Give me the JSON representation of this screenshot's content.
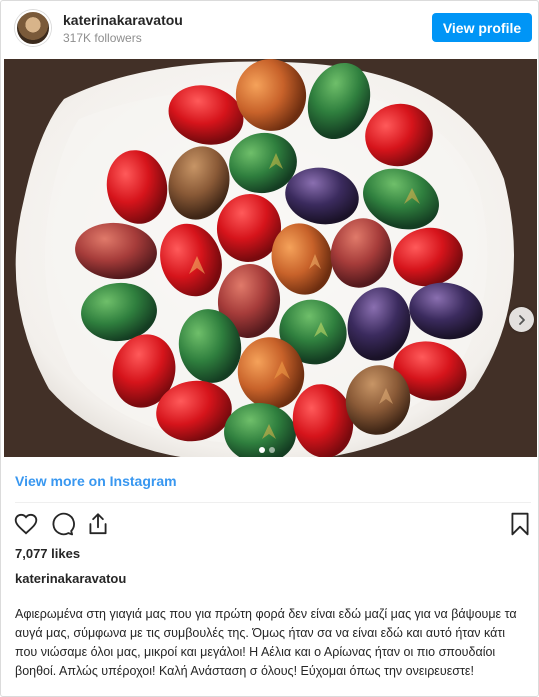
{
  "header": {
    "username": "katerinakaravatou",
    "followers": "317K followers",
    "view_profile_label": "View profile"
  },
  "post": {
    "alt_description": "Plate of dyed Easter eggs",
    "view_more_label": "View more on Instagram",
    "likes": "7,077 likes",
    "owner": "katerinakaravatou",
    "caption": "Αφιερωμένα στη γιαγιά μας που για πρώτη φορά δεν είναι εδώ μαζί μας για να βάψουμε τα αυγά μας, σύμφωνα με τις συμβουλές της. Όμως ήταν σα να είναι εδώ και αυτό ήταν κάτι που νιώσαμε όλοι μας, μικροί και μεγάλοι! Η Αέλια και ο Αρίωνας ήταν οι πιο σπουδαίοι βοηθοί. Απλώς υπέροχοι! Καλή Ανάσταση σ όλους! Εύχομαι όπως την ονειρευεστε!",
    "carousel": {
      "total": 2,
      "active": 1
    }
  },
  "icons": {
    "like": "heart-icon",
    "comment": "comment-icon",
    "share": "share-icon",
    "save": "bookmark-icon",
    "next": "chevron-right-icon"
  },
  "colors": {
    "accent": "#0095f6",
    "link": "#3897f0",
    "text": "#262626",
    "muted": "#8e8e8e"
  }
}
